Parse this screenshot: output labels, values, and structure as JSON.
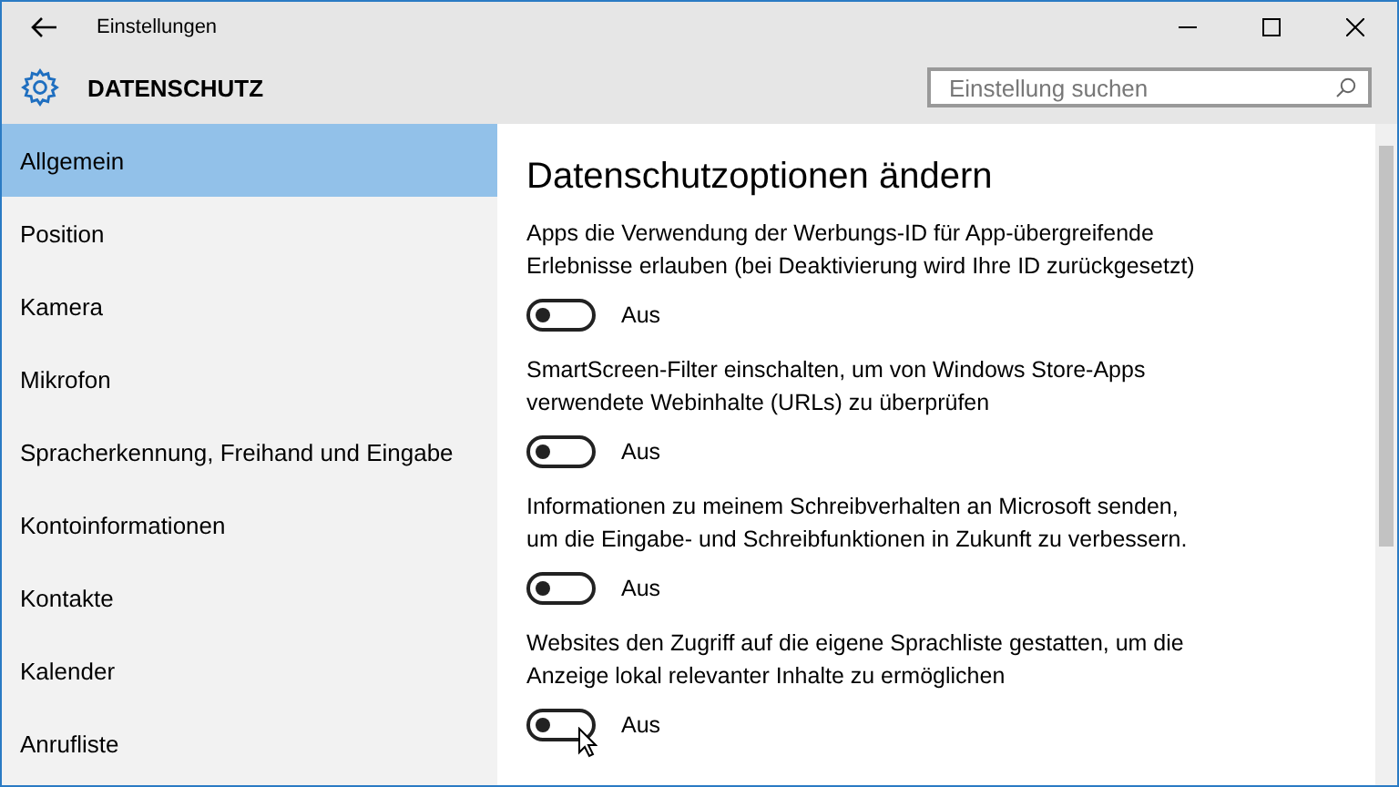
{
  "window": {
    "title": "Einstellungen"
  },
  "header": {
    "title": "DATENSCHUTZ",
    "search": {
      "placeholder": "Einstellung suchen"
    }
  },
  "sidebar": {
    "items": [
      {
        "label": "Allgemein",
        "selected": true
      },
      {
        "label": "Position",
        "selected": false
      },
      {
        "label": "Kamera",
        "selected": false
      },
      {
        "label": "Mikrofon",
        "selected": false
      },
      {
        "label": "Spracherkennung, Freihand und Eingabe",
        "selected": false
      },
      {
        "label": "Kontoinformationen",
        "selected": false
      },
      {
        "label": "Kontakte",
        "selected": false
      },
      {
        "label": "Kalender",
        "selected": false
      },
      {
        "label": "Anrufliste",
        "selected": false
      }
    ]
  },
  "content": {
    "heading": "Datenschutzoptionen ändern",
    "options": [
      {
        "text": "Apps die Verwendung der Werbungs-ID für App-übergreifende Erlebnisse erlauben (bei Deaktivierung wird Ihre ID zurückgesetzt)",
        "on": false,
        "state_label": "Aus"
      },
      {
        "text": "SmartScreen-Filter einschalten, um von Windows Store-Apps verwendete Webinhalte (URLs) zu überprüfen",
        "on": false,
        "state_label": "Aus"
      },
      {
        "text": "Informationen zu meinem Schreibverhalten an Microsoft senden, um die Eingabe- und Schreibfunktionen in Zukunft zu verbessern.",
        "on": false,
        "state_label": "Aus"
      },
      {
        "text": "Websites den Zugriff auf die eigene Sprachliste gestatten, um die Anzeige lokal relevanter Inhalte zu ermöglichen",
        "on": false,
        "state_label": "Aus",
        "hovered": true
      }
    ]
  }
}
